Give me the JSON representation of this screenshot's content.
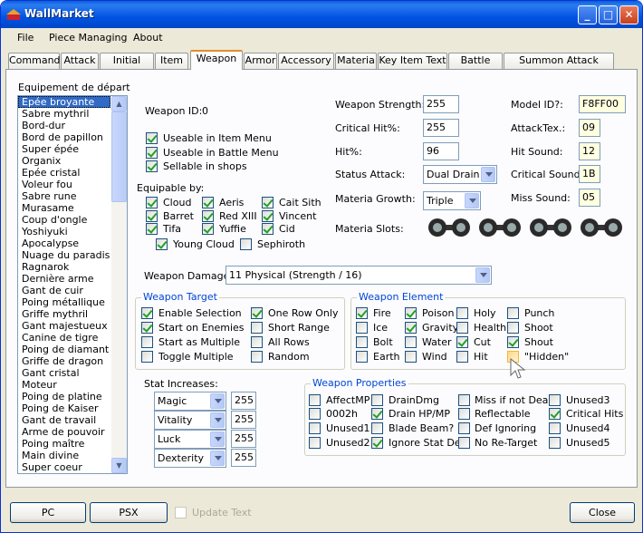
{
  "window": {
    "title": "WallMarket",
    "minimize": "_",
    "maximize": "□",
    "close": "✕"
  },
  "menu": [
    "File",
    "Piece Managing",
    "About"
  ],
  "tabs": [
    "Command",
    "Attack",
    "Initial Data",
    "Item",
    "Weapon",
    "Armor",
    "Accessory",
    "Materia",
    "Key Item Text",
    "Battle Text",
    "Summon Attack Names"
  ],
  "list": {
    "label": "Equipement de départ",
    "items": [
      "Epée broyante",
      "Sabre mythril",
      "Bord-dur",
      "Bord de papillon",
      "Super épée",
      "Organix",
      "Epée cristal",
      "Voleur fou",
      "Sabre rune",
      "Murasame",
      "Coup d'ongle",
      "Yoshiyuki",
      "Apocalypse",
      "Nuage du paradis",
      "Ragnarok",
      "Dernière arme",
      "Gant de cuir",
      "Poing métallique",
      "Griffe mythril",
      "Gant majestueux",
      "Canine de tigre",
      "Poing de diamant",
      "Griffe de dragon",
      "Gant cristal",
      "Moteur",
      "Poing de platine",
      "Poing de Kaiser",
      "Gant de travail",
      "Arme de pouvoir",
      "Poing maître",
      "Main divine",
      "Super coeur"
    ]
  },
  "weapon": {
    "id_label": "Weapon ID:",
    "id_value": "0",
    "useable_item": "Useable in Item Menu",
    "useable_battle": "Useable in Battle Menu",
    "sellable": "Sellable in shops",
    "equipable_label": "Equipable by:",
    "chars": [
      "Cloud",
      "Aeris",
      "Cait Sith",
      "Barret",
      "Red XIII",
      "Vincent",
      "Tifa",
      "Yuffie",
      "Cid"
    ],
    "young_cloud": "Young Cloud",
    "sephiroth": "Sephiroth",
    "strength_label": "Weapon Strength:",
    "strength": "255",
    "crit_label": "Critical Hit%:",
    "crit": "255",
    "hit_label": "Hit%:",
    "hit": "96",
    "status_label": "Status Attack:",
    "status": "Dual Drain",
    "growth_label": "Materia Growth:",
    "growth": "Triple",
    "slots_label": "Materia Slots:",
    "model_label": "Model ID?:",
    "model": "F8FF00",
    "attacktex_label": "AttackTex.:",
    "attacktex": "09",
    "hitsound_label": "Hit Sound:",
    "hitsound": "12",
    "critsound_label": "Critical Sound:",
    "critsound": "1B",
    "misssound_label": "Miss Sound:",
    "misssound": "05",
    "damage_label": "Weapon Damage:",
    "damage": "11 Physical (Strength / 16)"
  },
  "target": {
    "legend": "Weapon Target",
    "items": [
      "Enable Selection",
      "One Row Only",
      "Start on Enemies",
      "Short Range",
      "Start as Multiple",
      "All Rows",
      "Toggle Multiple",
      "Random"
    ]
  },
  "element": {
    "legend": "Weapon Element",
    "items": [
      "Fire",
      "Poison",
      "Holy",
      "Punch",
      "Ice",
      "Gravity",
      "Health",
      "Shoot",
      "Bolt",
      "Water",
      "Cut",
      "Shout",
      "Earth",
      "Wind",
      "Hit",
      "\"Hidden\""
    ]
  },
  "stats": {
    "label": "Stat Increases:",
    "rows": [
      {
        "stat": "Magic",
        "value": "255"
      },
      {
        "stat": "Vitality",
        "value": "255"
      },
      {
        "stat": "Luck",
        "value": "255"
      },
      {
        "stat": "Dexterity",
        "value": "255"
      }
    ]
  },
  "props": {
    "legend": "Weapon Properties",
    "items": [
      "AffectMP",
      "DrainDmg",
      "Miss if not Dead",
      "Unused3",
      "0002h",
      "Drain HP/MP",
      "Reflectable",
      "Critical Hits",
      "Unused1",
      "Blade Beam?",
      "Def Ignoring",
      "Unused4",
      "Unused2",
      "Ignore Stat Def",
      "No Re-Target",
      "Unused5"
    ]
  },
  "bottom": {
    "pc": "PC",
    "psx": "PSX",
    "update": "Update Text",
    "close": "Close"
  }
}
